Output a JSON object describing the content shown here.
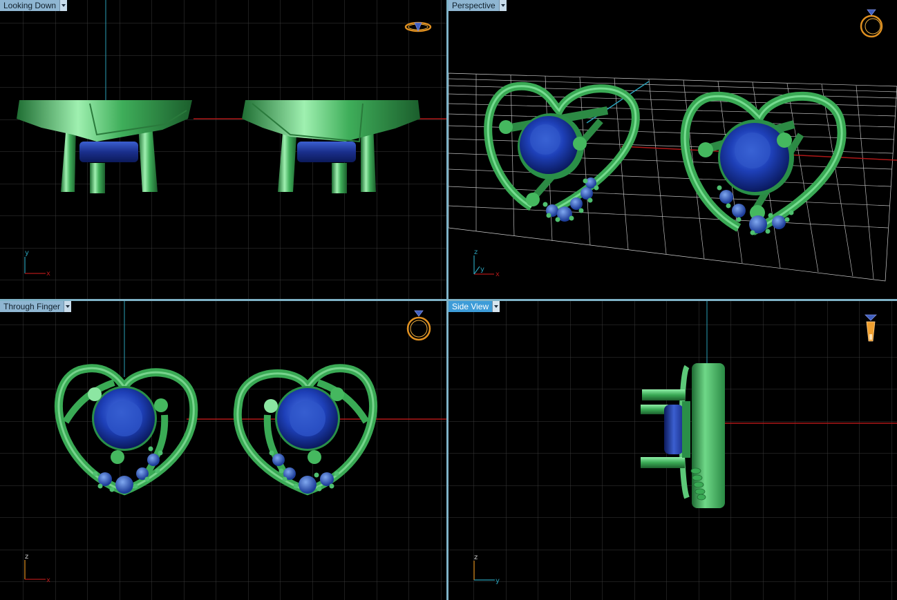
{
  "viewports": {
    "top_left": {
      "label": "Looking Down",
      "active": false
    },
    "top_right": {
      "label": "Perspective",
      "active": false
    },
    "bottom_left": {
      "label": "Through Finger",
      "active": false
    },
    "bottom_right": {
      "label": "Side View",
      "active": true
    }
  },
  "axes": {
    "top_left": {
      "v": "y",
      "h": "x"
    },
    "top_right": {
      "v": "z",
      "m": "y",
      "h": "x"
    },
    "bottom_left": {
      "v": "z",
      "h": "x"
    },
    "bottom_right": {
      "v": "z",
      "h": "y"
    }
  },
  "icons": {
    "top_left": "ring-orientation-top-icon",
    "top_right": "ring-orientation-perspective-icon",
    "bottom_left": "ring-orientation-front-icon",
    "bottom_right": "ring-orientation-side-icon"
  },
  "colors": {
    "grid": "#3a3a3a",
    "axis_red": "#b01818",
    "axis_blue": "#2aa0b8",
    "metal": "#3aaa55",
    "stone": "#1e3ea8",
    "label_bg": "#8fb6d2",
    "label_active_bg": "#3d9cd8"
  }
}
